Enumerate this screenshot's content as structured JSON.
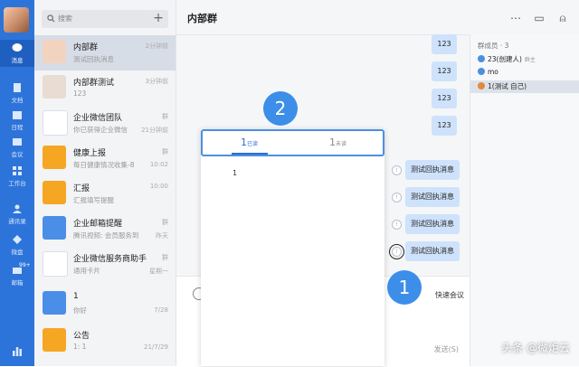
{
  "nav": {
    "items": [
      {
        "label": "消息",
        "icon": "message-icon"
      },
      {
        "label": "文档",
        "icon": "document-icon"
      },
      {
        "label": "日程",
        "icon": "calendar-icon"
      },
      {
        "label": "会议",
        "icon": "meeting-icon"
      },
      {
        "label": "工作台",
        "icon": "workbench-icon"
      },
      {
        "label": "通讯录",
        "icon": "contacts-icon"
      },
      {
        "label": "微盘",
        "icon": "drive-icon"
      },
      {
        "label": "邮箱",
        "icon": "mail-icon",
        "badge": "99+"
      }
    ]
  },
  "search": {
    "placeholder": "搜索"
  },
  "conversations": [
    {
      "name": "内部群",
      "preview": "测试回执消息",
      "time": "2分钟前",
      "selected": true
    },
    {
      "name": "内部群测试",
      "preview": "123",
      "time": "3分钟前"
    },
    {
      "name": "企业微信团队",
      "preview": "你已获得企业微信",
      "time": "21分钟前",
      "tag": "群"
    },
    {
      "name": "健康上报",
      "preview": "每日健康情况收集-8",
      "time": "10:02",
      "tag": "群"
    },
    {
      "name": "汇报",
      "preview": "汇报填写提醒",
      "time": "10:00"
    },
    {
      "name": "企业邮箱提醒",
      "preview": "腾讯视频: 会员服务到",
      "time": "昨天",
      "tag": "群"
    },
    {
      "name": "企业微信服务商助手",
      "preview": "通用卡片",
      "time": "星期一",
      "tag": "群"
    },
    {
      "name": "1",
      "preview": "你好",
      "time": "7/28"
    },
    {
      "name": "公告",
      "preview": "1: 1",
      "time": "21/7/29"
    }
  ],
  "chat": {
    "title": "内部群",
    "messages": [
      {
        "text": "123"
      },
      {
        "text": "123"
      },
      {
        "text": "123"
      },
      {
        "text": "123"
      },
      {
        "text": "测试回执消息"
      },
      {
        "text": "测试回执消息"
      },
      {
        "text": "测试回执消息"
      },
      {
        "text": "测试回执消息"
      }
    ],
    "receipt_symbol": "!",
    "quick_meeting": "快速会议",
    "send_label": "发送(S)"
  },
  "members": {
    "title": "群成员 · 3",
    "list": [
      {
        "name": "23(创建人)",
        "tag": "群主",
        "color": "#4a90e2"
      },
      {
        "name": "mo",
        "tag": "",
        "color": "#4a90e2"
      },
      {
        "name": "1(测试 自己)",
        "tag": "",
        "color": "#e08a3a",
        "selected": true
      }
    ]
  },
  "popup": {
    "read_count": "1",
    "read_label": "已读",
    "unread_count": "1",
    "unread_label": "未读",
    "read_list": [
      "1"
    ]
  },
  "annotations": {
    "one": "1",
    "two": "2"
  },
  "watermark": "头条 @微炬云",
  "colors": {
    "accent": "#2d74da",
    "bubble": "#cfe2fb",
    "annotation": "#3c8ee8"
  }
}
